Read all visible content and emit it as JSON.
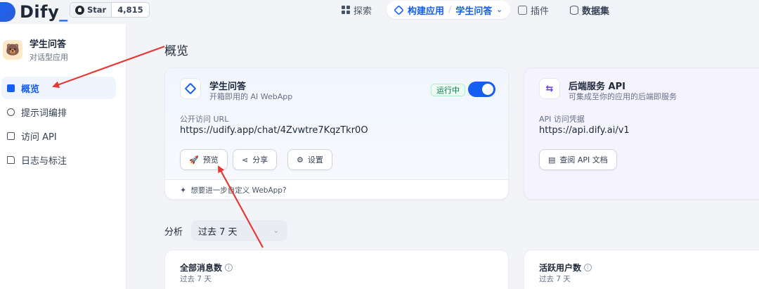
{
  "header": {
    "logo_text": "Dify",
    "github": {
      "star_label": "Star",
      "star_count": "4,815"
    },
    "nav": {
      "explore": "探索",
      "studio": "构建应用",
      "current_app": "学生问答",
      "plugins": "插件",
      "datasets": "数据集"
    }
  },
  "sidebar": {
    "app_name": "学生问答",
    "app_type": "对话型应用",
    "items": [
      {
        "label": "概览",
        "active": true
      },
      {
        "label": "提示词编排",
        "active": false
      },
      {
        "label": "访问 API",
        "active": false
      },
      {
        "label": "日志与标注",
        "active": false
      }
    ]
  },
  "main": {
    "title": "概览",
    "webapp_card": {
      "title": "学生问答",
      "subtitle": "开箱即用的 AI WebApp",
      "status": "运行中",
      "enabled": true,
      "url_label": "公开访问 URL",
      "url_value": "https://udify.app/chat/4Zvwtre7KqzTkr0O",
      "buttons": {
        "preview": "预览",
        "share": "分享",
        "settings": "设置"
      },
      "footer": "想要进一步自定义 WebApp?"
    },
    "api_card": {
      "title": "后端服务 API",
      "subtitle": "可集成至你的应用的后端即服务",
      "key_label": "API 访问凭据",
      "endpoint": "https://api.dify.ai/v1",
      "doc_button": "查阅 API 文档"
    },
    "analysis": {
      "label": "分析",
      "range": "过去 7 天"
    },
    "stats": [
      {
        "title": "全部消息数",
        "sub": "过去 7 天"
      },
      {
        "title": "活跃用户数",
        "sub": "过去 7 天"
      }
    ]
  },
  "colors": {
    "accent": "#155eef",
    "annotation_arrow": "#e53935",
    "status_green": "#067647"
  }
}
